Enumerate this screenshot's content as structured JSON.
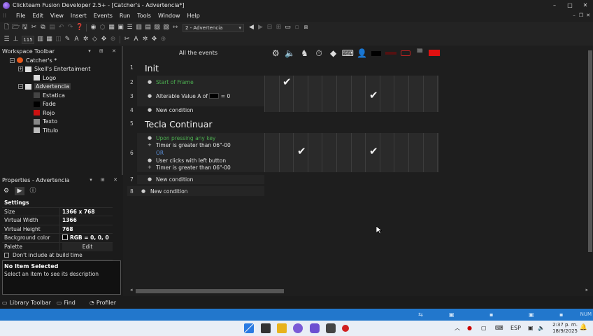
{
  "window": {
    "title": "Clickteam Fusion Developer 2.5+ - [Catcher's - Advertencia*]",
    "controls": [
      "–",
      "□",
      "✕"
    ],
    "mdi_controls": [
      "–",
      "❐",
      "✕"
    ]
  },
  "menu": [
    "File",
    "Edit",
    "View",
    "Insert",
    "Events",
    "Run",
    "Tools",
    "Window",
    "Help"
  ],
  "toolbar": {
    "frame_selector": "2 - Advertencia",
    "zoom": "115"
  },
  "workspace": {
    "title": "Workspace Toolbar",
    "header_controls": "▾ ⊞ ✕",
    "tree": [
      {
        "label": "Catcher's *",
        "level": 0,
        "expander": "−",
        "icon_color": "#e85a1c"
      },
      {
        "label": "Skell's Entertaiment",
        "level": 1,
        "expander": "+",
        "icon_color": "#dddddd"
      },
      {
        "label": "Logo",
        "level": 2,
        "expander": "",
        "icon_color": "#dddddd"
      },
      {
        "label": "Advertencia",
        "level": 1,
        "expander": "−",
        "icon_color": "#dddddd",
        "selected": true
      },
      {
        "label": "Estatica",
        "level": 2,
        "expander": "",
        "icon_color": "#444444"
      },
      {
        "label": "Fade",
        "level": 2,
        "expander": "",
        "icon_color": "#000000"
      },
      {
        "label": "Rojo",
        "level": 2,
        "expander": "",
        "icon_color": "#cc1111"
      },
      {
        "label": "Texto",
        "level": 2,
        "expander": "",
        "icon_color": "#888888"
      },
      {
        "label": "Titulo",
        "level": 2,
        "expander": "",
        "icon_color": "#bbbbbb"
      }
    ]
  },
  "properties": {
    "title": "Properties - Advertencia",
    "header_controls": "▾ ⊞ ✕",
    "tab_icons": [
      "gear-icon",
      "play-icon",
      "info-icon"
    ],
    "section": "Settings",
    "rows": [
      {
        "key": "Size",
        "value": "1366 x 768"
      },
      {
        "key": "Virtual Width",
        "value": "1366"
      },
      {
        "key": "Virtual Height",
        "value": "768"
      },
      {
        "key": "Background color",
        "value": "RGB = 0, 0, 0"
      },
      {
        "key": "Palette",
        "value": "Edit"
      }
    ],
    "checkbox_label": "Don't include at build time",
    "desc_title": "No Item Selected",
    "desc_text": "Select an item to see its description"
  },
  "event_editor": {
    "header": "All the events",
    "groups": [
      {
        "num": "1",
        "title": "Init"
      },
      {
        "num": "5",
        "title": "Tecla Continuar"
      }
    ],
    "rows": [
      {
        "num": "2",
        "text": "Start of Frame",
        "color": "green"
      },
      {
        "num": "3",
        "text": "Alterable Value A of",
        "suffix": "= 0"
      },
      {
        "num": "4",
        "text": "New condition"
      },
      {
        "num": "",
        "text": "Upon pressing any key",
        "color": "green"
      },
      {
        "num": "",
        "text": "Timer is greater than 06\"-00",
        "bullet": "+"
      },
      {
        "num": "6",
        "text": "OR",
        "color": "blue",
        "bullet": ""
      },
      {
        "num": "",
        "text": "User clicks with left button"
      },
      {
        "num": "",
        "text": "Timer is greater than 06\"-00",
        "bullet": "+"
      },
      {
        "num": "7",
        "text": "New condition"
      },
      {
        "num": "8",
        "text": "New condition"
      }
    ],
    "check_glyph": "✔"
  },
  "bottom_tabs": [
    "Library Toolbar",
    "Find",
    "Profiler"
  ],
  "status": {
    "num": "NUM"
  },
  "taskbar": {
    "lang": "ESP",
    "time": "2:37 p. m.",
    "date": "18/9/2025"
  }
}
